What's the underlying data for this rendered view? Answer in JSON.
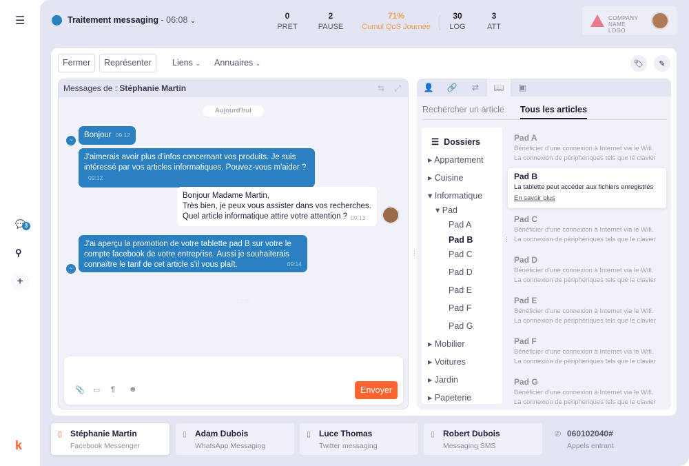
{
  "sidebar": {
    "chat_badge": "3",
    "logo": "k"
  },
  "header": {
    "status_color": "#2a80c0",
    "title": "Traitement messaging",
    "timer": "- 06:08",
    "stats": [
      {
        "value": "0",
        "label": "PRET"
      },
      {
        "value": "2",
        "label": "PAUSE"
      },
      {
        "value": "71%",
        "label": "Cumul QoS Journée",
        "accent": "#f0a050"
      },
      {
        "value": "30",
        "label": "LOG"
      },
      {
        "value": "3",
        "label": "ATT"
      }
    ],
    "company_logo": "COMPANY NAME LOGO"
  },
  "toolbar": {
    "close": "Fermer",
    "represent": "Représenter",
    "links": "Liens",
    "directories": "Annuaires"
  },
  "chat": {
    "prefix": "Messages de :",
    "contact": "Stéphanie Martin",
    "date": "Aujourd'hui",
    "messages": [
      {
        "text": "Bonjour",
        "time": "09:12"
      },
      {
        "text": "J'aimerais avoir plus d'infos concernant vos produits. Je suis intéressé par vos articles informatiques. Pouvez-vous m'aider ?",
        "time": "09:12"
      },
      {
        "text": "Bonjour Madame Martin,\nTrès bien, je peux vous assister dans vos recherches.\nQuel article informatique attire votre attention ?",
        "time": "09:13"
      },
      {
        "text": "J'ai aperçu la promotion de votre tablette pad B sur votre le compte facebook de votre entreprise. Aussi je souhaiterais connaître le tarif de cet article s'il vous plaît.",
        "time": "09:14"
      }
    ],
    "faint_time": "13:05",
    "send": "Envoyer"
  },
  "knowledge": {
    "search_tab": "Rechercher un article",
    "all_tab": "Tous les articles",
    "folders_title": "Dossiers",
    "folders": [
      "Appartement",
      "Cuisine",
      "Informatique",
      "Pad",
      "Pad A",
      "Pad B",
      "Pad C",
      "Pad D",
      "Pad E",
      "Pad F",
      "Pad G",
      "Mobilier",
      "Voitures",
      "Jardin",
      "Papeterie"
    ],
    "articles": [
      {
        "name": "Pad A",
        "desc": "Bénéficier d'une connexion à Internet via le Wifi. La connexion de périphériques tels que le clavier"
      },
      {
        "name": "Pad B",
        "desc": "La tablette peut accéder aux fichiers enregistrés",
        "link": "En savoir plus"
      },
      {
        "name": "Pad C",
        "desc": "Bénéficier d'une connexion à Internet via le Wifi. La connexion de périphériques tels que le clavier"
      },
      {
        "name": "Pad D",
        "desc": "Bénéficier d'une connexion à Internet via le Wifi. La connexion de périphériques tels que le clavier"
      },
      {
        "name": "Pad E",
        "desc": "Bénéficier d'une connexion à Internet via le Wifi. La connexion de périphériques tels que le clavier"
      },
      {
        "name": "Pad F",
        "desc": "Bénéficier d'une connexion à Internet via le Wifi. La connexion de périphériques tels que le clavier"
      },
      {
        "name": "Pad G",
        "desc": "Bénéficier d'une connexion à Internet via le Wifi. La connexion de périphériques tels que le clavier"
      }
    ]
  },
  "sessions": [
    {
      "name": "Stéphanie Martin",
      "channel": "Facebook Messenger"
    },
    {
      "name": "Adam Dubois",
      "channel": "WhatsApp Messaging"
    },
    {
      "name": "Luce Thomas",
      "channel": "Twitter messaging"
    },
    {
      "name": "Robert Dubois",
      "channel": "Messaging SMS"
    },
    {
      "name": "060102040#",
      "channel": "Appels entrant"
    }
  ]
}
